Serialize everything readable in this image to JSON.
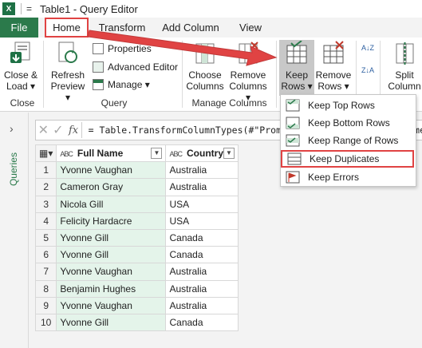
{
  "window": {
    "logo_text": "X",
    "title_separator": "=",
    "title": "Table1 - Query Editor"
  },
  "tabs": [
    {
      "label": "File"
    },
    {
      "label": "Home"
    },
    {
      "label": "Transform"
    },
    {
      "label": "Add Column"
    },
    {
      "label": "View"
    }
  ],
  "ribbon": {
    "close_load": {
      "line1": "Close &",
      "line2": "Load"
    },
    "refresh": {
      "line1": "Refresh",
      "line2": "Preview"
    },
    "properties": "Properties",
    "advanced_editor": "Advanced Editor",
    "manage": "Manage",
    "choose_columns": {
      "line1": "Choose",
      "line2": "Columns"
    },
    "remove_columns": {
      "line1": "Remove",
      "line2": "Columns"
    },
    "keep_rows": {
      "line1": "Keep",
      "line2": "Rows"
    },
    "remove_rows": {
      "line1": "Remove",
      "line2": "Rows"
    },
    "split_column": {
      "line1": "Split",
      "line2": "Column"
    },
    "groups": {
      "close": "Close",
      "query": "Query",
      "manage_columns": "Manage Columns"
    },
    "sort_icon_labels": [
      "A↓Z",
      "Z↓A"
    ]
  },
  "rail": {
    "label": "Queries"
  },
  "formula_bar": {
    "cancel": "✕",
    "accept": "✓",
    "fx": "fx",
    "text": "= Table.TransformColumnTypes(#\"Promoted Headers\",{{\"Full Name\", type text}, {\"Country\", type"
  },
  "table": {
    "type_label": "ABC",
    "columns": [
      "Full Name",
      "Country"
    ],
    "rows": [
      {
        "n": "1",
        "name": "Yvonne Vaughan",
        "country": "Australia"
      },
      {
        "n": "2",
        "name": "Cameron Gray",
        "country": "Australia"
      },
      {
        "n": "3",
        "name": "Nicola Gill",
        "country": "USA"
      },
      {
        "n": "4",
        "name": "Felicity Hardacre",
        "country": "USA"
      },
      {
        "n": "5",
        "name": "Yvonne Gill",
        "country": "Canada"
      },
      {
        "n": "6",
        "name": "Yvonne Gill",
        "country": "Canada"
      },
      {
        "n": "7",
        "name": "Yvonne Vaughan",
        "country": "Australia"
      },
      {
        "n": "8",
        "name": "Benjamin Hughes",
        "country": "Australia"
      },
      {
        "n": "9",
        "name": "Yvonne Vaughan",
        "country": "Australia"
      },
      {
        "n": "10",
        "name": "Yvonne Gill",
        "country": "Canada"
      }
    ]
  },
  "keep_rows_menu": {
    "items": [
      "Keep Top Rows",
      "Keep Bottom Rows",
      "Keep Range of Rows",
      "Keep Duplicates",
      "Keep Errors"
    ]
  },
  "colors": {
    "accent_green": "#2b7a4b",
    "highlight_red": "#e04343",
    "column_tint": "#e4f4ea"
  }
}
